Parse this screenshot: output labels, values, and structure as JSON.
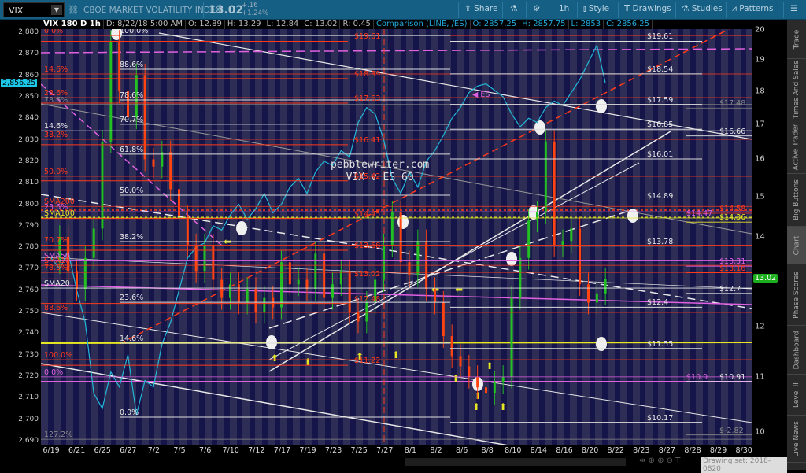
{
  "header": {
    "symbol": "VIX",
    "description": "CBOE MARKET VOLATILITY INDEX",
    "last": "13.02",
    "change": "+.16",
    "change_pct": "+1.24%",
    "buttons": {
      "share": "Share",
      "interval": "1h",
      "style": "Style",
      "drawings": "Drawings",
      "studies": "Studies",
      "patterns": "Patterns"
    }
  },
  "info": {
    "study": "VIX 180 D 1h",
    "date": "D: 8/22/18 5:00 AM",
    "open": "O: 12.89",
    "high": "H: 13.29",
    "low": "L: 12.84",
    "close": "C: 13.02",
    "range": "R: 0.45",
    "comparison": "Comparison (LINE, /ES)",
    "c_open": "O: 2857.25",
    "c_high": "H: 2857.75",
    "c_low": "L: 2853",
    "c_close": "C: 2856.25"
  },
  "left_axis": {
    "ticks": [
      "2,880",
      "2,870",
      "2,860",
      "2,850",
      "2,840",
      "2,830",
      "2,820",
      "2,810",
      "2,800",
      "2,790",
      "2,780",
      "2,770",
      "2,760",
      "2,750",
      "2,740",
      "2,730",
      "2,720",
      "2,710",
      "2,700",
      "2,690"
    ],
    "current": "2,856.25"
  },
  "right_axis": {
    "ticks": [
      "20",
      "19",
      "18",
      "17",
      "16",
      "15",
      "14",
      "13",
      "12",
      "11",
      "10"
    ],
    "current": "13.02"
  },
  "dates": [
    "6/19",
    "6/21",
    "6/25",
    "6/27",
    "7/2",
    "7/5",
    "7/6",
    "7/10",
    "7/12",
    "7/17",
    "7/19",
    "7/23",
    "7/25",
    "7/27",
    "8/1",
    "8/2",
    "8/6",
    "8/8",
    "8/10",
    "8/14",
    "8/16",
    "8/20",
    "8/22",
    "8/23",
    "8/27",
    "8/28",
    "8/29",
    "8/30"
  ],
  "watermark": {
    "site": "pebblewriter.com",
    "subtitle": "VIX v ES 60"
  },
  "es_marker": "ES",
  "colors": {
    "up": "#22c022",
    "down": "#ff4411",
    "es_line": "#22b8d8",
    "red": "#ff3a1a",
    "magenta": "#e060e0",
    "yellow": "#e6e622",
    "white": "#e8e8e8",
    "gray": "#888888"
  },
  "chart_data": {
    "type": "line",
    "vix_series": [
      13.4,
      14.0,
      13.2,
      12.8,
      13.5,
      14.2,
      16.5,
      19.6,
      18.0,
      17.2,
      18.5,
      16.0,
      15.8,
      16.2,
      15.2,
      14.5,
      13.8,
      13.2,
      13.8,
      13.0,
      12.6,
      12.9,
      12.5,
      12.8,
      12.3,
      12.6,
      12.4,
      13.4,
      12.9,
      13.0,
      12.8,
      13.6,
      12.6,
      12.9,
      13.2,
      12.3,
      12.1,
      12.5,
      13.0,
      13.8,
      14.6,
      13.4,
      13.1,
      13.9,
      12.8,
      12.5,
      11.8,
      11.4,
      11.2,
      11.0,
      10.8,
      10.7,
      10.9,
      11.0,
      12.6,
      13.5,
      14.4,
      14.6,
      16.5,
      13.8,
      13.9,
      14.2,
      12.9,
      12.5,
      12.7,
      13.02
    ],
    "es_series": [
      2775,
      2770,
      2778,
      2760,
      2745,
      2712,
      2705,
      2722,
      2715,
      2730,
      2702,
      2718,
      2715,
      2735,
      2745,
      2760,
      2775,
      2780,
      2782,
      2790,
      2788,
      2795,
      2800,
      2793,
      2798,
      2805,
      2796,
      2800,
      2808,
      2812,
      2805,
      2815,
      2820,
      2818,
      2825,
      2822,
      2838,
      2845,
      2842,
      2830,
      2812,
      2805,
      2815,
      2808,
      2820,
      2825,
      2832,
      2840,
      2845,
      2852,
      2855,
      2856,
      2853,
      2850,
      2842,
      2836,
      2840,
      2838,
      2845,
      2848,
      2846,
      2852,
      2858,
      2866,
      2874,
      2856.25
    ],
    "vix_range": [
      10,
      20
    ],
    "es_range": [
      2690,
      2880
    ],
    "vix_scale": "log"
  },
  "levels": {
    "left_fib": [
      {
        "t": "0.0%",
        "v": 2878.5,
        "c": "red"
      },
      {
        "t": "14.6%",
        "v": 2860.6,
        "c": "red"
      },
      {
        "t": "23.6%",
        "v": 2849.6,
        "c": "red"
      },
      {
        "t": "78.6%",
        "v": 2846.4,
        "c": "gray"
      },
      {
        "t": "14.6%",
        "v": 2834.2,
        "c": "white"
      },
      {
        "t": "38.2%",
        "v": 2830.2,
        "c": "red"
      },
      {
        "t": "50.0%",
        "v": 2813,
        "c": "red"
      },
      {
        "t": "SMA200",
        "v": 2799,
        "c": "red"
      },
      {
        "t": "23.6%",
        "v": 2796.5,
        "c": "magenta"
      },
      {
        "t": "SMA100",
        "v": 2793.6,
        "c": "yellow"
      },
      {
        "t": "70.7%",
        "v": 2781,
        "c": "red"
      },
      {
        "t": "SMA50",
        "v": 2774,
        "c": "magenta"
      },
      {
        "t": "SMA10",
        "v": 2771.6,
        "c": "red"
      },
      {
        "t": "78.6%",
        "v": 2768.3,
        "c": "red"
      },
      {
        "t": "SMA20",
        "v": 2761,
        "c": "white"
      },
      {
        "t": "88.6%",
        "v": 2749.7,
        "c": "red"
      },
      {
        "t": "100.0%",
        "v": 2727.7,
        "c": "red"
      },
      {
        "t": "0.0%",
        "v": 2719.7,
        "c": "magenta"
      },
      {
        "t": "127.2%",
        "v": 2690.7,
        "c": "gray"
      }
    ],
    "mid_fib": [
      {
        "t": "100.0%",
        "v": 2878.5
      },
      {
        "t": "88.6%",
        "v": 2862.8
      },
      {
        "t": "78.6%",
        "v": 2848.5
      },
      {
        "t": "70.7%",
        "v": 2837.2
      },
      {
        "t": "61.8%",
        "v": 2823.3
      },
      {
        "t": "50.0%",
        "v": 2804.2
      },
      {
        "t": "38.2%",
        "v": 2782.6
      },
      {
        "t": "23.6%",
        "v": 2754.4
      },
      {
        "t": "14.6%",
        "v": 2735.4
      },
      {
        "t": "0.0%",
        "v": 2701
      }
    ],
    "center": [
      {
        "t": "$19.61",
        "v": 19.61
      },
      {
        "t": "$18.39",
        "v": 18.39
      },
      {
        "t": "$17.63",
        "v": 17.63
      },
      {
        "t": "$16.41",
        "v": 16.41
      },
      {
        "t": "$15.42",
        "v": 15.42
      },
      {
        "t": "$14.45",
        "v": 14.45
      },
      {
        "t": "$13.68",
        "v": 13.68
      },
      {
        "t": "$13.02",
        "v": 13.02
      },
      {
        "t": "$12.48",
        "v": 12.48
      },
      {
        "t": "$11.22",
        "v": 11.22
      }
    ],
    "right": [
      {
        "t": "$19.61",
        "v": 19.61
      },
      {
        "t": "$18.54",
        "v": 18.54
      },
      {
        "t": "$17.59",
        "v": 17.59
      },
      {
        "t": "$16.85",
        "v": 16.85
      },
      {
        "t": "$16.01",
        "v": 16.01
      },
      {
        "t": "$14.89",
        "v": 14.89
      },
      {
        "t": "$13.78",
        "v": 13.78
      },
      {
        "t": "$12.4",
        "v": 12.4
      },
      {
        "t": "$11.55",
        "v": 11.55
      },
      {
        "t": "$10.17",
        "v": 10.17
      }
    ],
    "far_right": [
      {
        "t": "$17.48",
        "v": 17.48,
        "c": "gray"
      },
      {
        "t": "$16.66",
        "v": 16.66,
        "c": "white"
      },
      {
        "t": "$14.58",
        "v": 14.58,
        "c": "red"
      },
      {
        "t": "$14.36",
        "v": 14.36,
        "c": "yellow"
      },
      {
        "t": "$13.31",
        "v": 13.31,
        "c": "magenta"
      },
      {
        "t": "$13.16",
        "v": 13.16,
        "c": "red"
      },
      {
        "t": "$12.7",
        "v": 12.7,
        "c": "white"
      },
      {
        "t": "$10.91",
        "v": 10.91,
        "c": "white"
      },
      {
        "t": "$-2.82",
        "v": 9.95,
        "c": "gray"
      }
    ],
    "inner": [
      {
        "t": "$14.47",
        "v": 14.47,
        "c": "magenta"
      },
      {
        "t": "$10.9",
        "v": 10.9,
        "c": "magenta"
      }
    ]
  },
  "footer": {
    "drawing_set": "Drawing set: 2018-0820"
  },
  "sidebar": [
    "Trade",
    "Times And Sales",
    "Active Trader",
    "Big Buttons",
    "Chart",
    "Phase Scores",
    "Dashboard",
    "Level II",
    "Live News"
  ]
}
